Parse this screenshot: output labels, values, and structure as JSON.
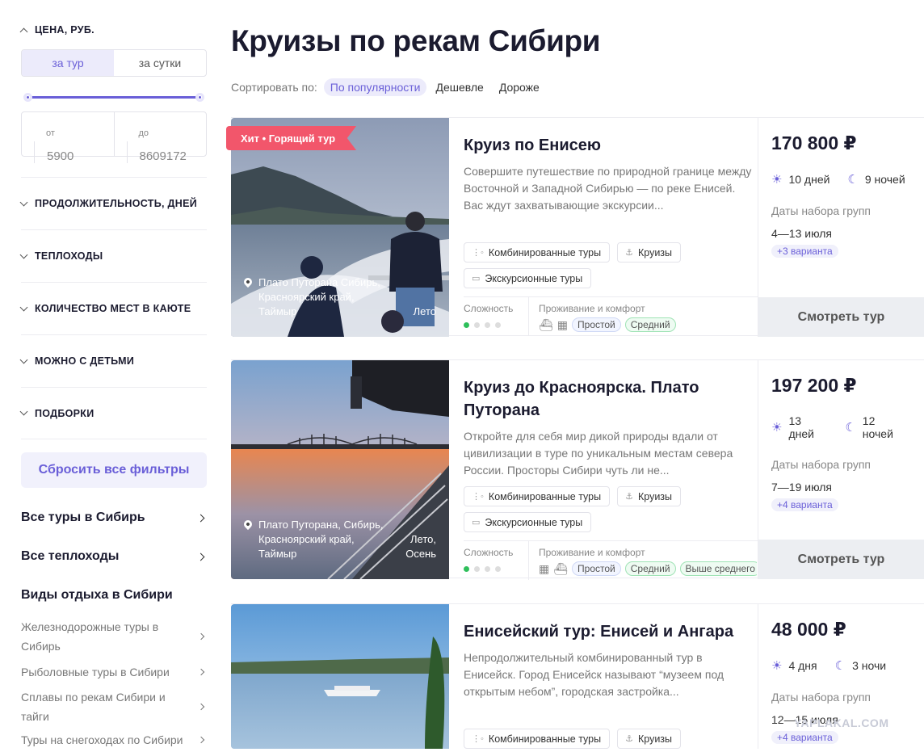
{
  "sidebar": {
    "price_title": "ЦЕНА, РУБ.",
    "toggle": [
      "за тур",
      "за сутки"
    ],
    "from_label": "от",
    "from_value": "5900",
    "to_label": "до",
    "to_value": "8609172",
    "filters": [
      "ПРОДОЛЖИТЕЛЬНОСТЬ, ДНЕЙ",
      "ТЕПЛОХОДЫ",
      "КОЛИЧЕСТВО МЕСТ В КАЮТЕ",
      "МОЖНО С ДЕТЬМИ",
      "ПОДБОРКИ"
    ],
    "reset": "Сбросить все фильтры",
    "link_all_tours": "Все туры в Сибирь",
    "link_ships": "Все теплоходы",
    "kinds_title": "Виды отдыха в Сибири",
    "kinds": [
      "Железнодорожные туры в Сибирь",
      "Рыболовные туры в Сибири",
      "Сплавы по рекам Сибири и тайги",
      "Туры на снегоходах по Сибири"
    ]
  },
  "page": {
    "title": "Круизы по рекам Сибири",
    "sort_label": "Сортировать по:",
    "sort_options": [
      "По популярности",
      "Дешевле",
      "Дороже"
    ]
  },
  "labels": {
    "difficulty": "Сложность",
    "comfort": "Проживание и комфорт",
    "groups": "Даты набора групп",
    "see": "Смотреть тур"
  },
  "cards": [
    {
      "badge": "Хит  •  Горящий тур",
      "place": "Плато Путорана Сибирь, Красноярский край, Таймыр",
      "season": "Лето",
      "title": "Круиз по Енисею",
      "desc": "Совершите путешествие по природной границе между Восточной и Западной Сибирью — по реке Енисей.  Вас ждут захватывающие экскурсии...",
      "tags": [
        "Комбинированные туры",
        "Круизы",
        "Экскурсионные туры"
      ],
      "levels": [
        "Простой",
        "Средний"
      ],
      "price": "170 800 ₽",
      "days": "10 дней",
      "nights": "9 ночей",
      "dates": "4—13 июля",
      "variants": "+3 варианта"
    },
    {
      "badge": "",
      "place": "Плато Путорана, Сибирь, Красноярский край, Таймыр",
      "season": "Лето, Осень",
      "title": "Круиз до Красноярска. Плато Путорана",
      "desc": "Откройте для себя мир дикой природы вдали от цивилизации в туре по уникальным местам севера России. Просторы Сибири чуть ли не...",
      "tags": [
        "Комбинированные туры",
        "Круизы",
        "Экскурсионные туры"
      ],
      "levels": [
        "Простой",
        "Средний",
        "Выше среднего"
      ],
      "price": "197 200 ₽",
      "days": "13 дней",
      "nights": "12 ночей",
      "dates": "7—19 июля",
      "variants": "+4 варианта"
    },
    {
      "badge": "",
      "place": "",
      "season": "",
      "title": "Енисейский тур: Енисей и Ангара",
      "desc": "Непродолжительный комбинированный тур в Енисейск. Город Енисейск называют “музеем под открытым небом”, городская застройка...",
      "tags": [
        "Комбинированные туры",
        "Круизы"
      ],
      "levels": [],
      "price": "48 000 ₽",
      "days": "4 дня",
      "nights": "3 ночи",
      "dates": "12—15 июля",
      "variants": "+4 варианта"
    }
  ],
  "watermark": "YAPLAKAL.COM"
}
